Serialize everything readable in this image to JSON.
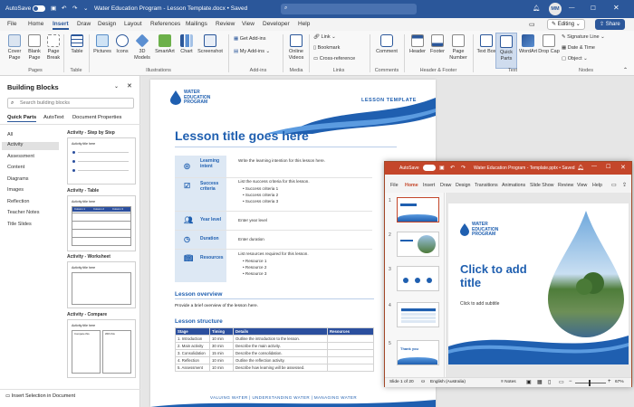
{
  "word": {
    "autosave_label": "AutoSave",
    "autosave_state": "On",
    "title": "Water Education Program - Lesson Template.docx • Saved",
    "user_initials": "MM",
    "tabs": [
      "File",
      "Home",
      "Insert",
      "Draw",
      "Design",
      "Layout",
      "References",
      "Mailings",
      "Review",
      "View",
      "Developer",
      "Help"
    ],
    "active_tab": "Insert",
    "editing_label": "Editing",
    "share_label": "Share",
    "ribbon": {
      "pages_buttons": [
        "Cover Page",
        "Blank Page",
        "Page Break"
      ],
      "pages_group": "Pages",
      "table_button": "Table",
      "table_group": "Table",
      "illustration_buttons": [
        "Pictures",
        "Icons",
        "3D Models",
        "SmartArt",
        "Chart",
        "Screenshot"
      ],
      "illustrations_group": "Illustrations",
      "addins_items": [
        "Get Add-ins",
        "My Add-ins"
      ],
      "addins_group": "Add-ins",
      "media_button": "Online Videos",
      "media_group": "Media",
      "links_items": [
        "Link",
        "Bookmark",
        "Cross-reference"
      ],
      "links_group": "Links",
      "comment_button": "Comment",
      "comments_group": "Comments",
      "hf_buttons": [
        "Header",
        "Footer",
        "Page Number"
      ],
      "hf_group": "Header & Footer",
      "text_buttons": [
        "Text Box",
        "Quick Parts",
        "WordArt",
        "Drop Cap"
      ],
      "text_group": "Text",
      "symbols_items": [
        "Signature Line",
        "Date & Time",
        "Object"
      ],
      "symbols_group": "Nodes"
    }
  },
  "pane": {
    "title": "Building Blocks",
    "search_placeholder": "Search building blocks",
    "tabs": [
      "Quick Parts",
      "AutoText",
      "Document Properties"
    ],
    "categories": [
      "All",
      "Activity",
      "Assessment",
      "Content",
      "Diagrams",
      "Images",
      "Reflection",
      "Teacher Notes",
      "Title Slides"
    ],
    "selected_category": "Activity",
    "gallery": [
      {
        "label": "Activity - Step by Step",
        "inner_title": "Activity title here"
      },
      {
        "label": "Activity - Table",
        "inner_title": "Activity title here",
        "columns": [
          "Column 1",
          "Column 2",
          "Column 3"
        ]
      },
      {
        "label": "Activity - Worksheet",
        "inner_title": "Activity title here"
      },
      {
        "label": "Activity - Compare",
        "inner_title": "Activity title here",
        "columns": [
          "Compare this",
          "With this"
        ]
      }
    ],
    "footer_action": "Insert Selection in Document"
  },
  "doc": {
    "logo_lines": [
      "WATER",
      "EDUCATION",
      "PROGRAM"
    ],
    "header_right": "LESSON TEMPLATE",
    "title": "Lesson title goes here",
    "info_rows": [
      {
        "label": "Learning intent",
        "text": [
          "Write the learning intention for this lesson here."
        ]
      },
      {
        "label": "Success criteria",
        "text": [
          "List the success criteria for this lesson.",
          "• Success criteria 1",
          "• Success criteria 2",
          "• Success criteria 3"
        ]
      },
      {
        "label": "Year level",
        "text": [
          "Enter year level"
        ]
      },
      {
        "label": "Duration",
        "text": [
          "Enter duration"
        ]
      },
      {
        "label": "Resources",
        "text": [
          "List resources required for this lesson.",
          "• Resource 1",
          "• Resource 2",
          "• Resource 3"
        ]
      }
    ],
    "overview_heading": "Lesson overview",
    "overview_text": "Provide a brief overview of the lesson here.",
    "structure_heading": "Lesson structure",
    "structure_table": {
      "headers": [
        "Stage",
        "Timing",
        "Details",
        "Resources"
      ],
      "rows": [
        [
          "1. Introduction",
          "10 min",
          "Outline the introduction to the lesson.",
          ""
        ],
        [
          "2. Main activity",
          "30 min",
          "Describe the main activity.",
          ""
        ],
        [
          "3. Consolidation",
          "15 min",
          "Describe the consolidation.",
          ""
        ],
        [
          "4. Reflection",
          "10 min",
          "Outline the reflection activity.",
          ""
        ],
        [
          "5. Assessment",
          "10 min",
          "Describe how learning will be assessed.",
          ""
        ]
      ]
    },
    "footer": "VALUING WATER  |  UNDERSTANDING WATER  |  MANAGING WATER"
  },
  "ppt": {
    "autosave_label": "AutoSave",
    "autosave_state": "On",
    "title": "Water Education Program - Template.pptx • Saved",
    "tabs": [
      "File",
      "Home",
      "Insert",
      "Draw",
      "Design",
      "Transitions",
      "Animations",
      "Slide Show",
      "Review",
      "View",
      "Help"
    ],
    "active_tab": "Home",
    "thumb_numbers": [
      "1",
      "2",
      "3",
      "4",
      "5"
    ],
    "thumb5_text": "Thank you",
    "slide": {
      "logo_lines": [
        "WATER",
        "EDUCATION",
        "PROGRAM"
      ],
      "title_line1": "Click to add",
      "title_line2": "title",
      "subtitle": "Click to add subtitle"
    },
    "status_slide": "Slide 1 of 20",
    "status_lang": "English (Australia)",
    "status_notes": "Notes",
    "zoom": "67%"
  },
  "colors": {
    "word_blue": "#2b579a",
    "ppt_red": "#c4462a",
    "doc_blue": "#1f5fb0"
  }
}
